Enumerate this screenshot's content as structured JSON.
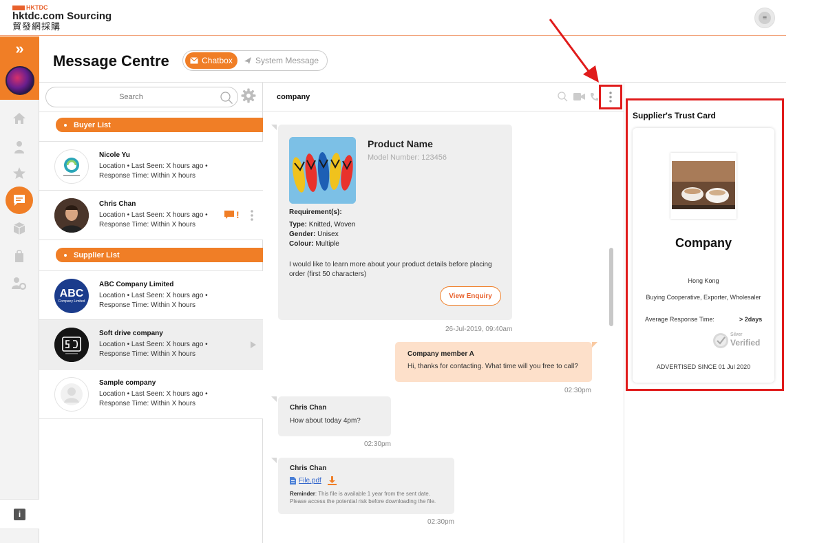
{
  "header": {
    "brand_top": "HKTDC",
    "brand_main": "hktdc.com Sourcing",
    "brand_cn": "貿發網採購"
  },
  "page": {
    "title": "Message Centre",
    "tabs": [
      {
        "label": "Chatbox",
        "active": true
      },
      {
        "label": "System Message",
        "active": false
      }
    ]
  },
  "search": {
    "placeholder": "Search"
  },
  "buyer_list": {
    "label": "Buyer List",
    "contacts": [
      {
        "name": "Nicole Yu",
        "meta1": "Location  •  Last Seen: X hours ago  •",
        "meta2": "Response Time: Within X hours"
      },
      {
        "name": "Chris Chan",
        "meta1": "Location  •  Last Seen: X hours ago  •",
        "meta2": "Response Time: Within X hours",
        "alert": "!"
      }
    ]
  },
  "supplier_list": {
    "label": "Supplier List",
    "contacts": [
      {
        "name": "ABC Company Limited",
        "meta1": "Location  •  Last Seen: X hours ago  •",
        "meta2": "Response Time: Within X hours",
        "logo_text": "ABC",
        "logo_sub": "Company Limited"
      },
      {
        "name": "Soft drive company",
        "meta1": "Location  •  Last Seen: X hours ago  •",
        "meta2": "Response Time: Within X hours",
        "selected": true
      },
      {
        "name": "Sample company",
        "meta1": "Location  •  Last Seen: X hours ago  •",
        "meta2": "Response Time: Within X hours"
      }
    ]
  },
  "chat": {
    "title": "company",
    "enquiry": {
      "product_name": "Product Name",
      "model_number": "Model Number: 123456",
      "req_heading": "Requirement(s):",
      "type_label": "Type:",
      "type_value": "Knitted, Woven",
      "gender_label": "Gender:",
      "gender_value": "Unisex",
      "colour_label": "Colour:",
      "colour_value": "Multiple",
      "message_line1": "I would like to learn more about your product details before placing",
      "message_line2": "order (first 50 characters)",
      "button": "View Enquiry",
      "time": "26-Jul-2019, 09:40am"
    },
    "msg_company": {
      "sender": "Company member A",
      "text": "Hi, thanks for contacting. What time will you free to call?",
      "time": "02:30pm"
    },
    "msg_chris": {
      "sender": "Chris Chan",
      "text": "How about today 4pm?",
      "time": "02:30pm"
    },
    "msg_file": {
      "sender": "Chris Chan",
      "file": "File.pdf",
      "reminder_label": "Reminder",
      "reminder_line1": ": This file is available 1 year from the sent date.",
      "reminder_line2": "Please access the potential risk before downloading the file.",
      "time": "02:30pm"
    }
  },
  "trust_card": {
    "title": "Supplier's Trust Card",
    "company": "Company",
    "location": "Hong Kong",
    "business_type": "Buying Cooperative, Exporter, Wholesaler",
    "response_label": "Average Response Time:",
    "response_value": "> 2days",
    "verified_level": "Silver",
    "verified_label": "Verified",
    "advertised": "ADVERTISED SINCE 01 Jul 2020"
  },
  "colors": {
    "accent": "#f07e26",
    "highlight": "#e01b1b"
  }
}
